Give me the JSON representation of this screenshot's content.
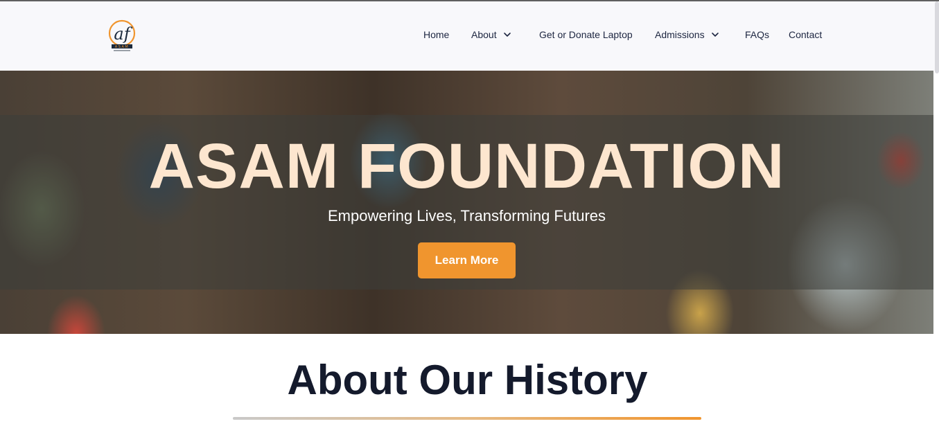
{
  "brand": {
    "logo_letters": "af",
    "logo_caption": "ASAM",
    "accent_color": "#f0952e",
    "icon": "asam-foundation-logo"
  },
  "nav": {
    "items": [
      {
        "label": "Home",
        "has_dropdown": false
      },
      {
        "label": "About",
        "has_dropdown": true,
        "icon": "chevron-down-icon"
      },
      {
        "label": "Get or Donate Laptop",
        "has_dropdown": false
      },
      {
        "label": "Admissions",
        "has_dropdown": true,
        "icon": "chevron-down-icon"
      },
      {
        "label": "FAQs",
        "has_dropdown": false
      },
      {
        "label": "Contact",
        "has_dropdown": false
      }
    ]
  },
  "hero": {
    "title": "ASAM FOUNDATION",
    "subtitle": "Empowering Lives, Transforming Futures",
    "cta_label": "Learn More",
    "title_color": "#fde6cf"
  },
  "history": {
    "title": "About Our History"
  }
}
